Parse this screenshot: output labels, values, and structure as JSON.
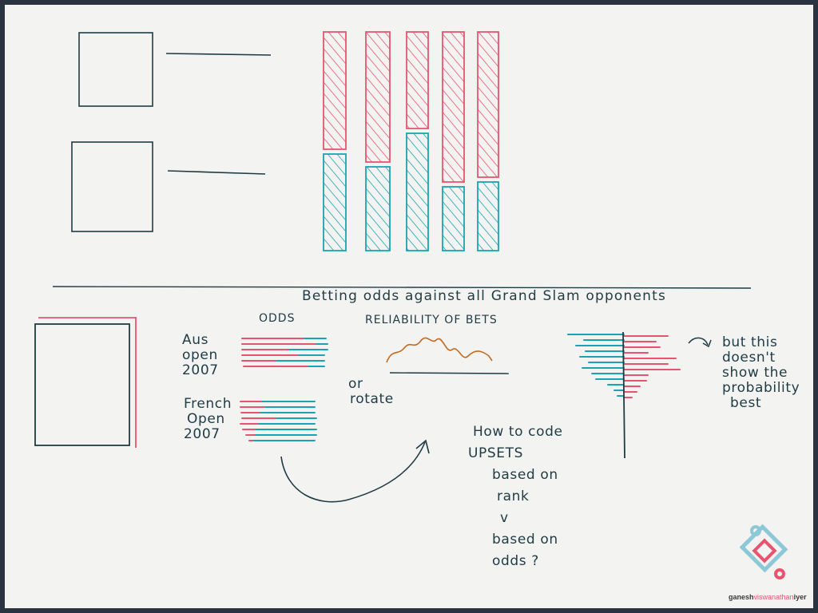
{
  "colors": {
    "ink": "#1f3b44",
    "pink": "#e8546f",
    "teal": "#1aa3b3",
    "brown": "#c26a22",
    "paper": "#f3f3f1"
  },
  "section_title": "Betting odds against all Grand Slam opponents",
  "odds_header": "ODDS",
  "reliability_header": "RELIABILITY OF BETS",
  "tournaments": [
    {
      "line1": "Aus",
      "line2": "open",
      "line3": "2007"
    },
    {
      "line1": "French",
      "line2": "Open",
      "line3": "2007"
    }
  ],
  "or_rotate": {
    "line1": "or",
    "line2": "rotate"
  },
  "upsets_note": [
    "How to code",
    "UPSETS",
    "based on",
    "rank",
    "v",
    "based on",
    "odds ?"
  ],
  "side_note": [
    "but this",
    "doesn't",
    "show the",
    "probability",
    "best"
  ],
  "watermark": {
    "part1": "ganesh",
    "part2": "viswanathan",
    "part3": "iyer",
    "color1": "#3a3a3a",
    "color2": "#e8546f",
    "color3": "#3a3a3a"
  },
  "stacked_bars": [
    {
      "top": 0.55,
      "bottom": 0.45
    },
    {
      "top": 0.61,
      "bottom": 0.39
    },
    {
      "top": 0.45,
      "bottom": 0.55
    },
    {
      "top": 0.7,
      "bottom": 0.3
    },
    {
      "top": 0.68,
      "bottom": 0.32
    }
  ]
}
